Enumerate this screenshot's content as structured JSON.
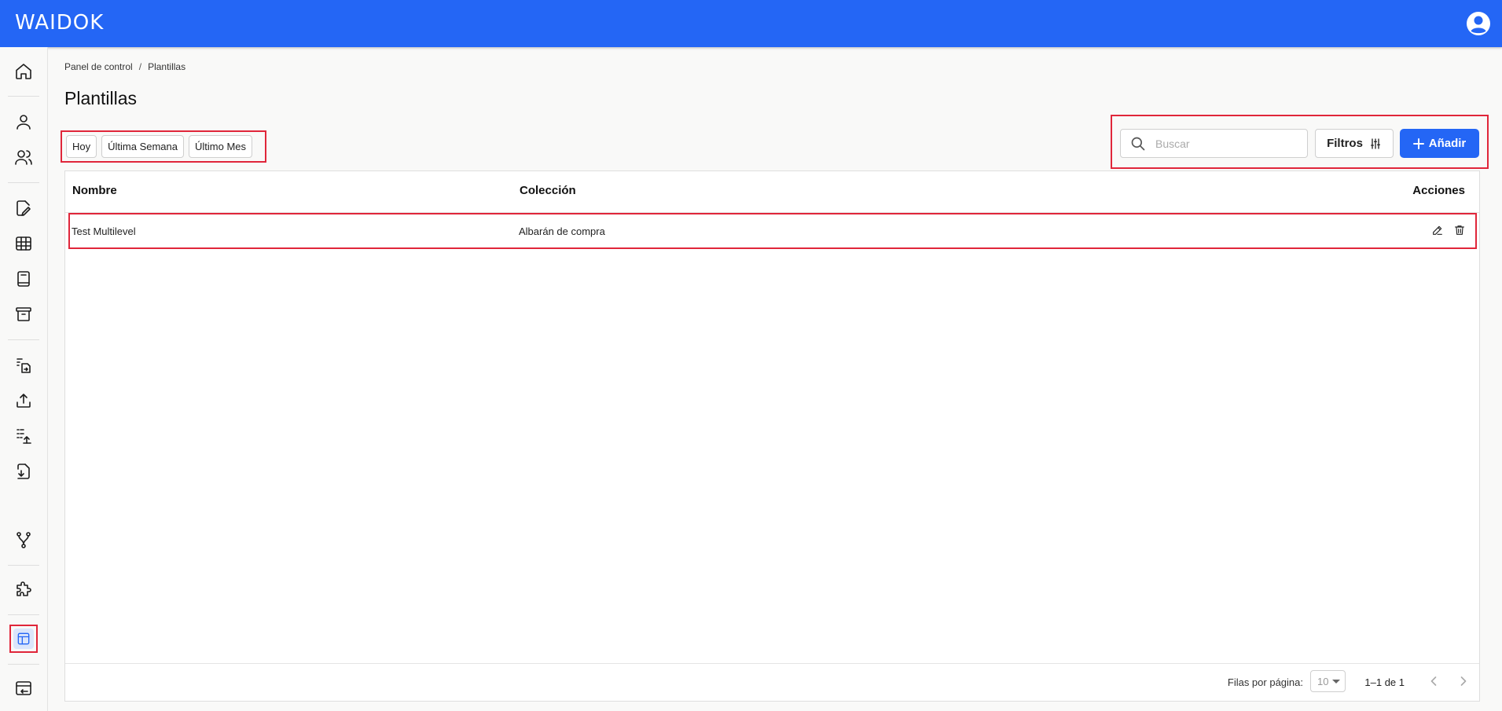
{
  "header": {
    "logo_text": "WAIDOK",
    "brand_color": "#2466f5"
  },
  "sidebar": {
    "items": [
      {
        "name": "home-icon"
      },
      {
        "name": "user-icon"
      },
      {
        "name": "users-icon"
      },
      {
        "name": "document-edit-icon"
      },
      {
        "name": "table-icon"
      },
      {
        "name": "book-icon"
      },
      {
        "name": "archive-icon"
      },
      {
        "name": "transfer-documents-icon"
      },
      {
        "name": "upload-icon"
      },
      {
        "name": "batch-upload-icon"
      },
      {
        "name": "file-download-icon"
      },
      {
        "name": "workflow-icon"
      },
      {
        "name": "puzzle-icon"
      },
      {
        "name": "templates-icon",
        "active": true
      },
      {
        "name": "import-export-icon"
      }
    ]
  },
  "breadcrumb": {
    "home": "Panel de control",
    "sep": "/",
    "current": "Plantillas"
  },
  "page": {
    "title": "Plantillas"
  },
  "date_filters": [
    "Hoy",
    "Última Semana",
    "Último Mes"
  ],
  "toolbar": {
    "search_placeholder": "Buscar",
    "filters_label": "Filtros",
    "add_label": "Añadir"
  },
  "table": {
    "columns": [
      "Nombre",
      "Colección",
      "Acciones"
    ],
    "rows": [
      {
        "nombre": "Test Multilevel",
        "coleccion": "Albarán de compra"
      }
    ]
  },
  "pagination": {
    "rows_per_page_label": "Filas por página:",
    "rows_per_page": "10",
    "range": "1–1 de 1"
  },
  "colors": {
    "highlight": "#e0263a"
  }
}
